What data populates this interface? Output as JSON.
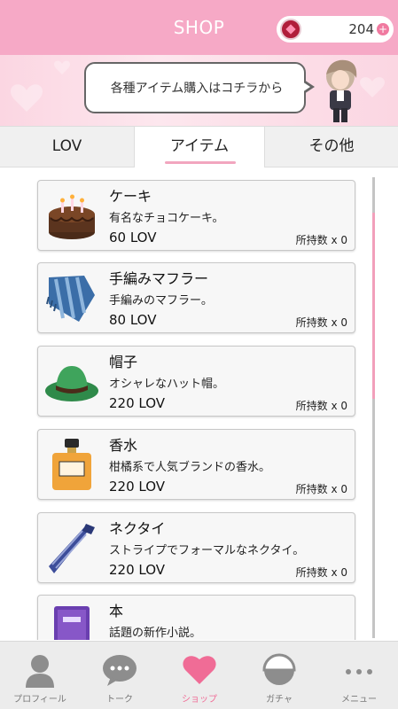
{
  "header": {
    "title": "SHOP",
    "currency_value": "204",
    "currency_plus": "+"
  },
  "banner": {
    "message": "各種アイテム購入はコチラから"
  },
  "tabs": [
    {
      "label": "LOV",
      "active": false
    },
    {
      "label": "アイテム",
      "active": true
    },
    {
      "label": "その他",
      "active": false
    }
  ],
  "items": [
    {
      "name": "ケーキ",
      "desc": "有名なチョコケーキ。",
      "price": "60 LOV",
      "owned": "所持数 x 0",
      "icon": "cake-icon"
    },
    {
      "name": "手編みマフラー",
      "desc": "手編みのマフラー。",
      "price": "80 LOV",
      "owned": "所持数 x 0",
      "icon": "scarf-icon"
    },
    {
      "name": "帽子",
      "desc": "オシャレなハット帽。",
      "price": "220 LOV",
      "owned": "所持数 x 0",
      "icon": "hat-icon"
    },
    {
      "name": "香水",
      "desc": "柑橘系で人気ブランドの香水。",
      "price": "220 LOV",
      "owned": "所持数 x 0",
      "icon": "perfume-icon"
    },
    {
      "name": "ネクタイ",
      "desc": "ストライプでフォーマルなネクタイ。",
      "price": "220 LOV",
      "owned": "所持数 x 0",
      "icon": "necktie-icon"
    },
    {
      "name": "本",
      "desc": "話題の新作小説。",
      "price": "",
      "owned": "",
      "icon": "book-icon"
    }
  ],
  "nav": [
    {
      "label": "プロフィール",
      "icon": "profile-icon",
      "active": false
    },
    {
      "label": "トーク",
      "icon": "chat-bubble-icon",
      "active": false
    },
    {
      "label": "ショップ",
      "icon": "heart-icon",
      "active": true
    },
    {
      "label": "ガチャ",
      "icon": "gacha-icon",
      "active": false
    },
    {
      "label": "メニュー",
      "icon": "more-dots-icon",
      "active": false
    }
  ],
  "colors": {
    "header_pink": "#f6a9c6",
    "accent_pink": "#f06c96",
    "tab_underline": "#f2a6bf"
  }
}
